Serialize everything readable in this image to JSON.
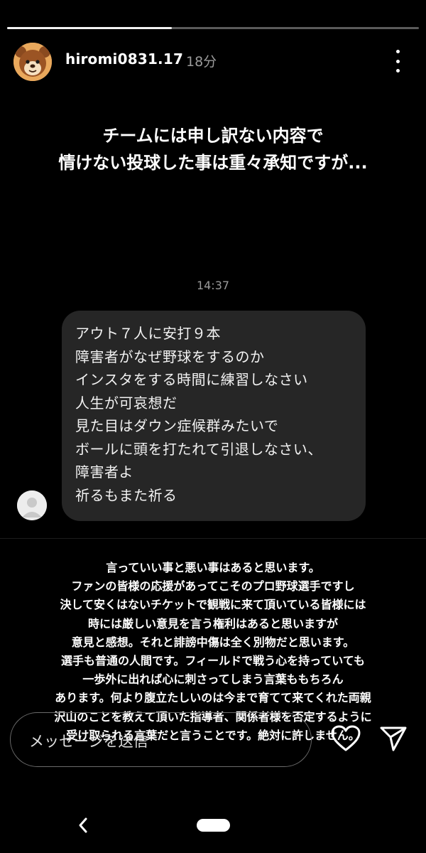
{
  "story": {
    "progress_fraction": 0.4,
    "username": "hiromi0831.17",
    "time_ago": "18分",
    "heading_lines": [
      "チームには申し訳ない内容で",
      "情けない投球した事は重々承知ですが..."
    ]
  },
  "dm": {
    "time": "14:37",
    "lines": [
      "アウト７人に安打９本",
      "障害者がなぜ野球をするのか",
      "インスタをする時間に練習しなさい",
      "人生が可哀想だ",
      "見た目はダウン症候群みたいで",
      "ボールに頭を打たれて引退しなさい、",
      "障害者よ",
      "祈るもまた祈る"
    ]
  },
  "statement": {
    "lines": [
      "言っていい事と悪い事はあると思います。",
      "ファンの皆様の応援があってこそのプロ野球選手ですし",
      "決して安くはないチケットで観戦に来て頂いている皆様には",
      "時には厳しい意見を言う権利はあると思いますが",
      "意見と感想。それと誹謗中傷は全く別物だと思います。",
      "選手も普通の人間です。フィールドで戦う心を持っていても",
      "一歩外に出れば心に刺さってしまう言葉ももちろん",
      "あります。何より腹立たしいのは今まで育てて来てくれた両親",
      "沢山のことを教えて頂いた指導者、関係者様を否定するように",
      "受け取られる言葉だと言うことです。絶対に許しません。"
    ]
  },
  "reply": {
    "placeholder": "メッセージを送信"
  },
  "icons": {
    "more": "more-vertical-icon",
    "heart": "heart-icon",
    "send": "send-icon",
    "back": "back-icon"
  },
  "colors": {
    "background": "#000000",
    "bubble": "#262626",
    "secondary_text": "#9b9b9b"
  }
}
